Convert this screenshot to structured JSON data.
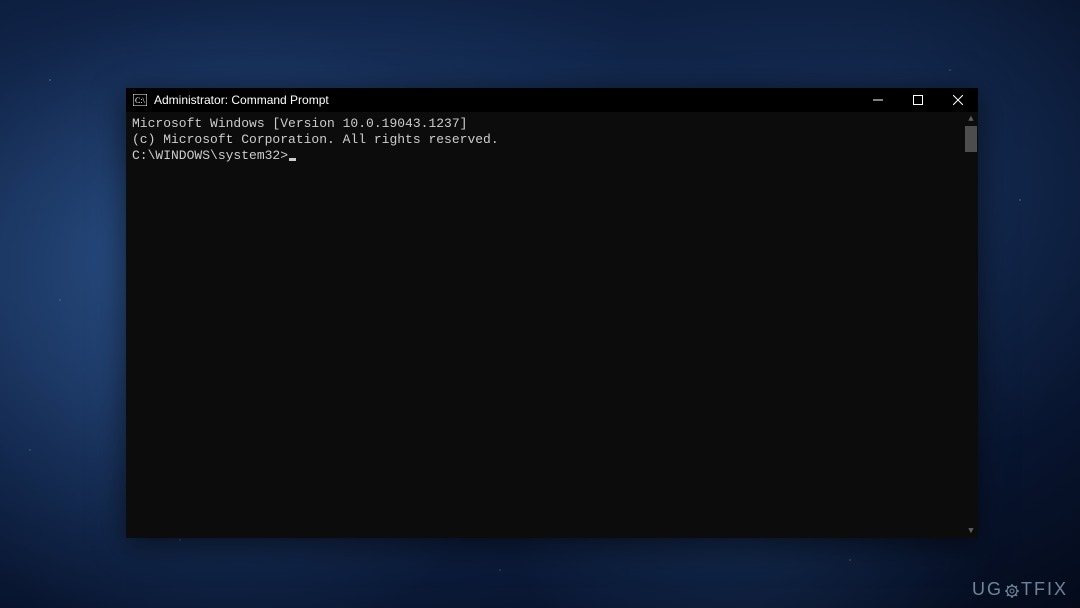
{
  "window": {
    "title": "Administrator: Command Prompt"
  },
  "terminal": {
    "line1": "Microsoft Windows [Version 10.0.19043.1237]",
    "line2": "(c) Microsoft Corporation. All rights reserved.",
    "blank": "",
    "prompt": "C:\\WINDOWS\\system32>"
  },
  "watermark": {
    "part1": "UG",
    "part2": "TFIX"
  }
}
